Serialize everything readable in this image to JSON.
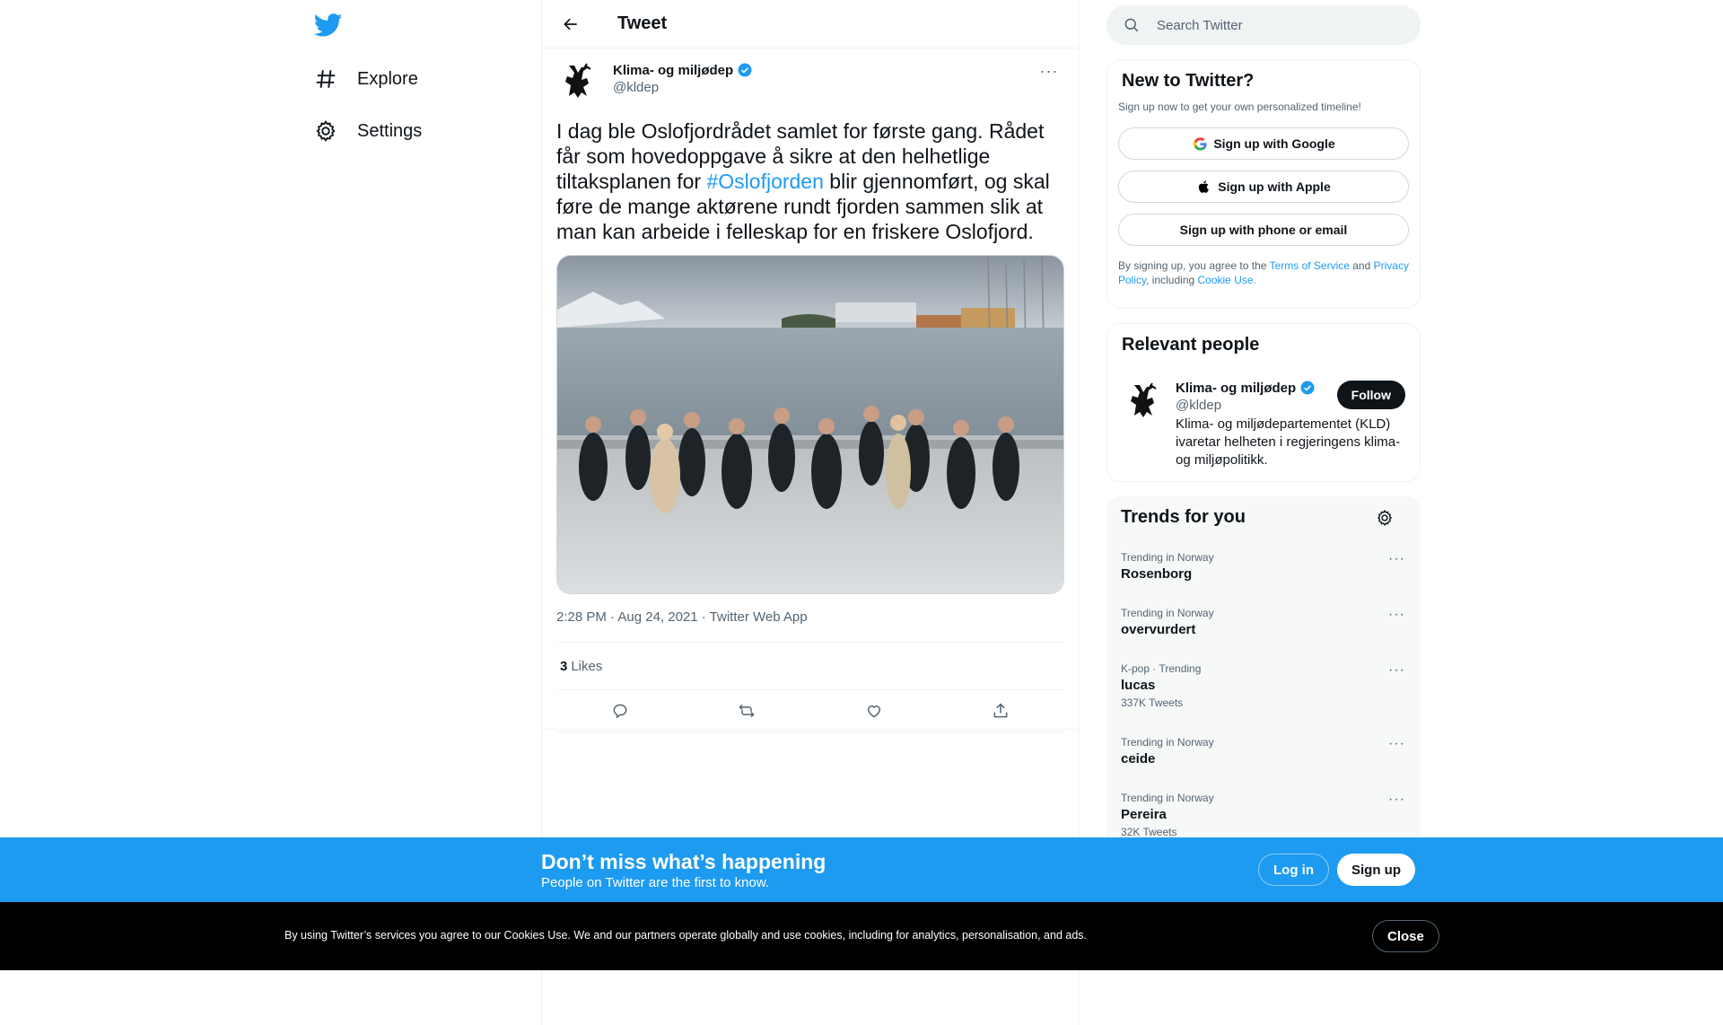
{
  "nav": {
    "logo": "twitter-bird-icon",
    "items": [
      {
        "label": "Explore",
        "icon": "hashtag-icon"
      },
      {
        "label": "Settings",
        "icon": "gear-icon"
      }
    ]
  },
  "header": {
    "title": "Tweet"
  },
  "tweet": {
    "author_name": "Klima- og miljødep",
    "author_handle": "@kldep",
    "more": "···",
    "text_before": "I dag ble Oslofjordrådet samlet for første gang. Rådet får som hovedoppgave å sikre at den helhetlige tiltaksplanen for ",
    "hashtag": "#Oslofjorden",
    "text_after": " blir gjennomført, og skal føre de mange aktørene rundt fjorden sammen slik at man kan arbeide i felleskap for en friskere Oslofjord.",
    "meta": "2:28 PM · Aug 24, 2021 · Twitter Web App",
    "likes_count": "3",
    "likes_label": "Likes"
  },
  "search": {
    "placeholder": "Search Twitter"
  },
  "new_to_twitter": {
    "title": "New to Twitter?",
    "subtitle": "Sign up now to get your own personalized timeline!",
    "google": "Sign up with Google",
    "apple": "Sign up with Apple",
    "phone": "Sign up with phone or email",
    "terms_1": "By signing up, you agree to the ",
    "terms_tos": "Terms of Service",
    "terms_2": " and ",
    "terms_privacy": "Privacy Policy",
    "terms_3": ", including ",
    "terms_cookie": "Cookie Use."
  },
  "relevant": {
    "title": "Relevant people",
    "name": "Klima- og miljødep",
    "handle": "@kldep",
    "bio": "Klima- og miljødepartementet (KLD) ivaretar helheten i regjeringens klima- og miljøpolitikk.",
    "follow": "Follow"
  },
  "trends": {
    "title": "Trends for you",
    "items": [
      {
        "context": "Trending in Norway",
        "name": "Rosenborg",
        "count": ""
      },
      {
        "context": "Trending in Norway",
        "name": "overvurdert",
        "count": ""
      },
      {
        "context": "K-pop · Trending",
        "name": "lucas",
        "count": "337K Tweets"
      },
      {
        "context": "Trending in Norway",
        "name": "ceide",
        "count": ""
      },
      {
        "context": "Trending in Norway",
        "name": "Pereira",
        "count": "32K Tweets"
      }
    ]
  },
  "bottom_bar": {
    "title": "Don’t miss what’s happening",
    "subtitle": "People on Twitter are the first to know.",
    "login": "Log in",
    "signup": "Sign up"
  },
  "cookie": {
    "text": "By using Twitter’s services you agree to our Cookies Use. We and our partners operate globally and use cookies, including for analytics, personalisation, and ads.",
    "close": "Close"
  },
  "colors": {
    "accent": "#1d9bf0",
    "text": "#0f1419",
    "muted": "#536471"
  }
}
